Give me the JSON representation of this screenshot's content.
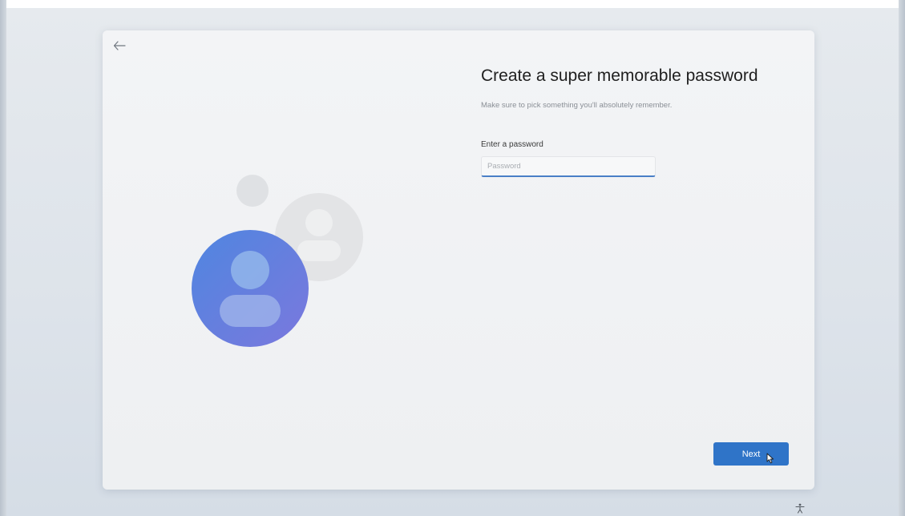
{
  "page": {
    "title": "Create a super memorable password",
    "subtitle": "Make sure to pick something you'll absolutely remember."
  },
  "password_field": {
    "label": "Enter a password",
    "placeholder": "Password",
    "value": ""
  },
  "actions": {
    "next_label": "Next"
  },
  "icons": {
    "back": "arrow-left-icon",
    "illustration": "user-avatar-illustration",
    "accessibility": "accessibility-icon",
    "cursor": "mouse-pointer-icon"
  },
  "colors": {
    "accent": "#2f74c8",
    "avatar_gradient_start": "#4f86e0",
    "avatar_gradient_end": "#7b78dd",
    "card_background": "#f3f4f6"
  }
}
